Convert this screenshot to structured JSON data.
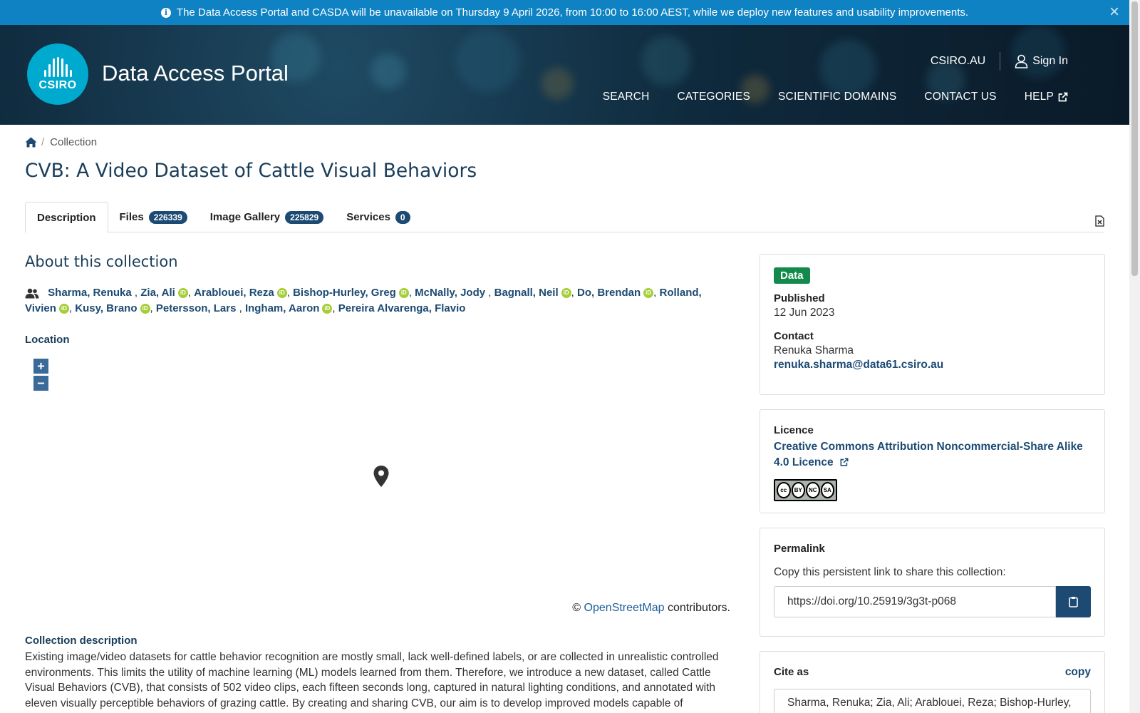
{
  "banner": {
    "message": "The Data Access Portal and CASDA will be unavailable on Thursday 9 April 2026, from 10:00 to 16:00 AEST, while we deploy new features and usability improvements.",
    "close_label": "×",
    "bg_color": "#0f82c4"
  },
  "header": {
    "logo_text": "CSIRO",
    "site_title": "Data Access Portal",
    "top_links": {
      "csiro": "CSIRO.AU",
      "sign_in": "Sign In"
    },
    "nav": [
      "SEARCH",
      "CATEGORIES",
      "SCIENTIFIC DOMAINS",
      "CONTACT US",
      "HELP"
    ]
  },
  "breadcrumb": {
    "current": "Collection"
  },
  "page": {
    "title": "CVB: A Video Dataset of Cattle Visual Behaviors"
  },
  "tabs": [
    {
      "label": "Description",
      "count": ""
    },
    {
      "label": "Files",
      "count": "226339"
    },
    {
      "label": "Image Gallery",
      "count": "225829"
    },
    {
      "label": "Services",
      "count": "0"
    }
  ],
  "about": {
    "heading": "About this collection",
    "authors": [
      {
        "name": "Sharma, Renuka",
        "orcid": false
      },
      {
        "name": "Zia, Ali",
        "orcid": true
      },
      {
        "name": "Arablouei, Reza",
        "orcid": true
      },
      {
        "name": "Bishop-Hurley, Greg",
        "orcid": true
      },
      {
        "name": "McNally, Jody",
        "orcid": false
      },
      {
        "name": "Bagnall, Neil",
        "orcid": true
      },
      {
        "name": "Do, Brendan",
        "orcid": true
      },
      {
        "name": "Rolland, Vivien",
        "orcid": true
      },
      {
        "name": "Kusy, Brano",
        "orcid": true
      },
      {
        "name": "Petersson, Lars",
        "orcid": false
      },
      {
        "name": "Ingham, Aaron",
        "orcid": true
      },
      {
        "name": "Pereira Alvarenga, Flavio",
        "orcid": false
      }
    ],
    "orcid_label": "iD",
    "location_label": "Location"
  },
  "map": {
    "zoom_in": "+",
    "zoom_out": "−",
    "credit_prefix": "©",
    "credit_link": "OpenStreetMap",
    "credit_suffix": "contributors."
  },
  "description": {
    "heading": "Collection description",
    "text": "Existing image/video datasets for cattle behavior recognition are mostly small, lack well-defined labels, or are collected in unrealistic controlled environments. This limits the utility of machine learning (ML) models learned from them. Therefore, we introduce a new dataset, called Cattle Visual Behaviors (CVB), that consists of 502 video clips, each fifteen seconds long, captured in natural lighting conditions, and annotated with eleven visually perceptible behaviors of grazing cattle. By creating and sharing CVB, our aim is to develop improved models capable of"
  },
  "sidebar": {
    "type_badge": "Data",
    "published_label": "Published",
    "published_value": "12 Jun 2023",
    "contact_label": "Contact",
    "contact_name": "Renuka Sharma",
    "contact_email": "renuka.sharma@data61.csiro.au",
    "licence_label": "Licence",
    "licence_link": "Creative Commons Attribution Noncommercial-Share Alike 4.0 Licence",
    "cc_icons": [
      "cc",
      "BY",
      "NC",
      "SA"
    ],
    "permalink_label": "Permalink",
    "permalink_help": "Copy this persistent link to share this collection:",
    "permalink_value": "https://doi.org/10.25919/3g3t-p068",
    "cite_label": "Cite as",
    "cite_copy": "copy",
    "cite_text": "Sharma, Renuka; Zia, Ali; Arablouei, Reza; Bishop-Hurley,"
  }
}
